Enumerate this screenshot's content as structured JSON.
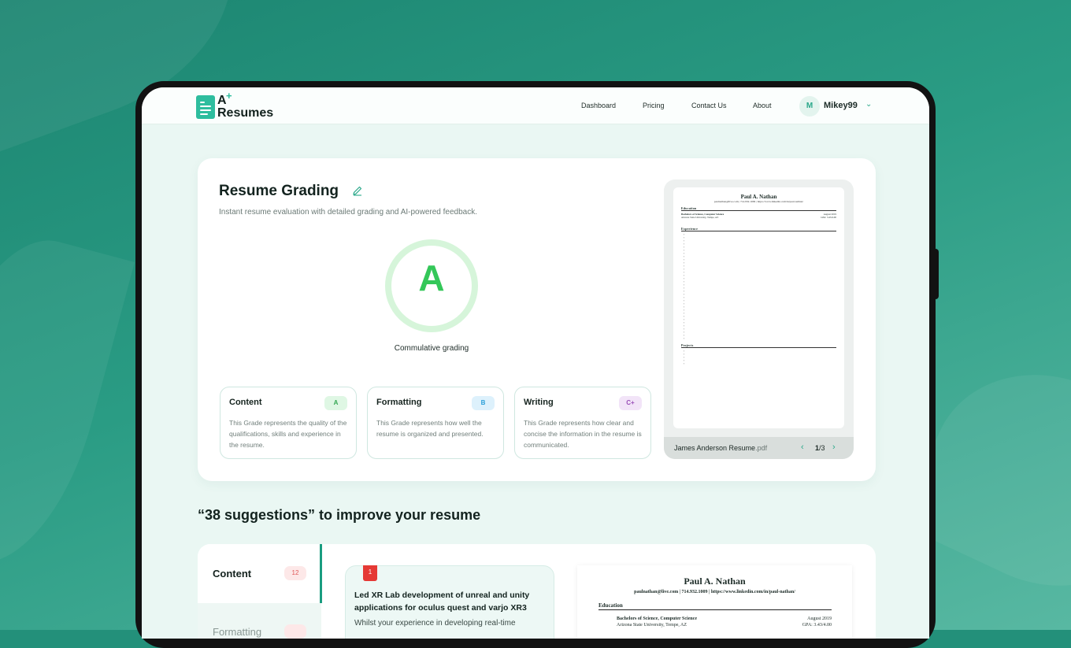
{
  "nav": {
    "logo_line1": "A",
    "logo_plus": "+",
    "logo_line2": "Resumes",
    "links": [
      "Dashboard",
      "Pricing",
      "Contact Us",
      "About"
    ],
    "avatar_initial": "M",
    "username": "Mikey99"
  },
  "grading": {
    "title": "Resume Grading",
    "subtitle": "Instant resume evaluation with detailed grading and AI-powered feedback.",
    "overall_grade": "A",
    "overall_label": "Commulative grading",
    "overall_color": "#34c759",
    "cards": [
      {
        "title": "Content",
        "grade": "A",
        "description": "This Grade represents the quality of the qualifications, skills and experience in the resume.",
        "badge_bg": "#dff7e4",
        "badge_color": "#34a853"
      },
      {
        "title": "Formatting",
        "grade": "B",
        "description": "This Grade represents how well the resume is organized and presented.",
        "badge_bg": "#ddf1fc",
        "badge_color": "#2b9fd8"
      },
      {
        "title": "Writing",
        "grade": "C+",
        "description": "This Grade represents how clear and concise the information in the resume is communicated.",
        "badge_bg": "#f2e4f8",
        "badge_color": "#9a4fb8"
      }
    ]
  },
  "preview": {
    "resume_name": "Paul A. Nathan",
    "resume_contact": "paulnathan@live.com | 714.932.1009 | https://www.linkedin.com/in/paul-nathan/",
    "section_education": "Education",
    "degree": "Bachelors of Science, Computer Science",
    "degree_date": "August 2019",
    "university": "Arizona State University, Tempe, AZ",
    "gpa": "GPA: 3.43/4.00",
    "section_experience": "Experience",
    "section_projects": "Projects",
    "file_name": "James Anderson Resume",
    "file_ext": ".pdf",
    "prev_icon": "chevron-left-icon",
    "next_icon": "chevron-right-icon",
    "page_current": "1",
    "page_total": "/3"
  },
  "suggestions": {
    "title": "“38 suggestions” to improve your resume",
    "tabs": [
      {
        "label": "Content",
        "count": "12"
      },
      {
        "label": "Formatting",
        "count": ""
      }
    ],
    "item": {
      "number": "1",
      "heading": "Led XR Lab development of unreal and unity applications for oculus quest and varjo XR3",
      "body": "Whilst your experience in developing real-time"
    }
  },
  "colors": {
    "accent": "#2ebd9e",
    "brand_dark": "#1a9d80",
    "background": "#23907a"
  }
}
